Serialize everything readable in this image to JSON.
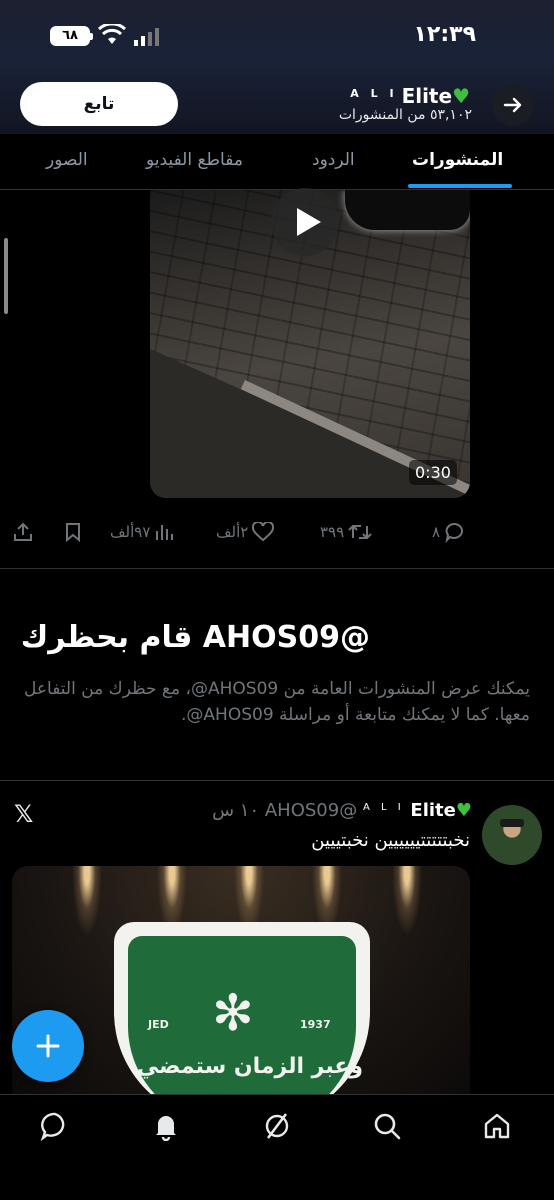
{
  "status_bar": {
    "time": "١٢:٣٩",
    "battery": "٦٨"
  },
  "header": {
    "follow_label": "تابع",
    "profile_name": "Elite",
    "profile_tag": "A L I",
    "post_count": "٥٣,١٠٢ من المنشورات"
  },
  "tabs": [
    {
      "label": "المنشورات",
      "active": true
    },
    {
      "label": "الردود"
    },
    {
      "label": "مقاطع الفيديو"
    },
    {
      "label": "الصور"
    }
  ],
  "video": {
    "duration": "0:30"
  },
  "post_actions": {
    "replies": "٨",
    "reposts": "٣٩٩",
    "likes": "٢ألف",
    "views": "٩٧ألف"
  },
  "blocked": {
    "title": "قام بحظرك AHOS09@",
    "description": "يمكنك عرض المنشورات العامة من AHOS09@، مع حظرك من التفاعل معها. كما لا يمكنك متابعة أو مراسلة AHOS09@."
  },
  "tweet": {
    "author_tag": "A L I",
    "author_name": "Elite",
    "handle": "AHOS09@",
    "time": "١٠ س",
    "text": "نخبتتتتتيييييين نخبتييين",
    "image_labels": {
      "left": "JED",
      "right": "1937",
      "motto": "وعبر الزمان ستمضي"
    }
  },
  "accent_color": "#1d9bf0"
}
